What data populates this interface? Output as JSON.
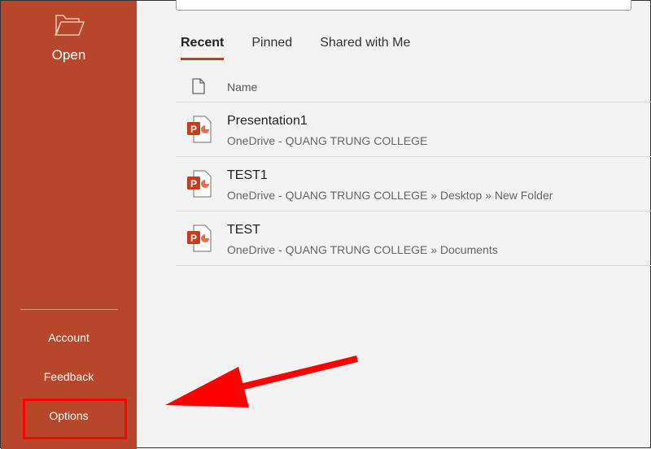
{
  "sidebar": {
    "open_label": "Open",
    "items": [
      {
        "label": "Account"
      },
      {
        "label": "Feedback"
      },
      {
        "label": "Options"
      }
    ]
  },
  "tabs": [
    {
      "label": "Recent"
    },
    {
      "label": "Pinned"
    },
    {
      "label": "Shared with Me"
    }
  ],
  "list": {
    "header": "Name",
    "files": [
      {
        "name": "Presentation1",
        "location": "OneDrive - QUANG TRUNG COLLEGE"
      },
      {
        "name": "TEST1",
        "location": "OneDrive - QUANG TRUNG COLLEGE » Desktop » New Folder"
      },
      {
        "name": "TEST",
        "location": "OneDrive - QUANG TRUNG COLLEGE » Documents"
      }
    ]
  },
  "colors": {
    "accent": "#b7472a",
    "annotation": "#ff0000"
  }
}
